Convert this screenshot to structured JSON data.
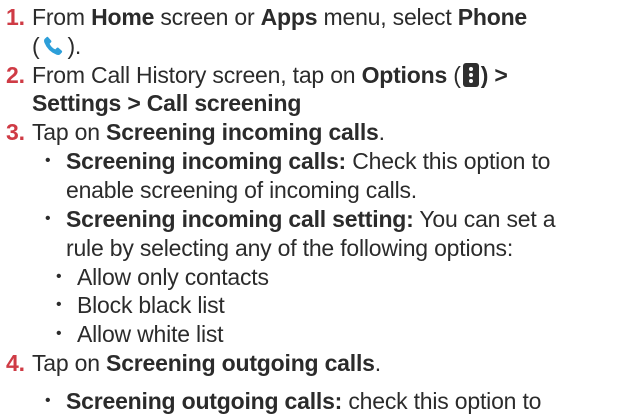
{
  "steps": [
    {
      "number": "1.",
      "l1_a": "From ",
      "l1_b": "Home",
      "l1_c": " screen or ",
      "l1_d": "Apps",
      "l1_e": " menu, select ",
      "l1_f": "Phone",
      "l2_open": "(",
      "l2_close": ").",
      "icon": "phone-icon"
    },
    {
      "number": "2.",
      "l1_a": "From Call History screen, tap on ",
      "l1_b": "Options",
      "l1_open": " (",
      "l1_close": ") >",
      "l2": "Settings > Call screening",
      "icon": "more-options-icon"
    },
    {
      "number": "3.",
      "l1_a": "Tap on ",
      "l1_b": "Screening incoming calls",
      "l1_c": ".",
      "bullets": [
        {
          "bold": "Screening incoming calls:",
          "text": " Check this option to",
          "cont": "enable screening of incoming calls."
        },
        {
          "bold": "Screening incoming call setting:",
          "text": " You can set a",
          "cont": "rule by selecting any of the following options:"
        }
      ],
      "sub_bullets": [
        "Allow only contacts",
        "Block black list",
        "Allow white list"
      ]
    },
    {
      "number": "4.",
      "l1_a": "Tap on ",
      "l1_b": "Screening outgoing calls",
      "l1_c": ".",
      "bullets": [
        {
          "bold": "Screening outgoing calls:",
          "text": " check this option to"
        }
      ]
    }
  ],
  "bullet_char": "•",
  "colors": {
    "step_number": "#cf3b45",
    "text": "#2b2b2b",
    "phone_icon": "#2d9fd9",
    "options_icon": "#2f2f2f"
  }
}
